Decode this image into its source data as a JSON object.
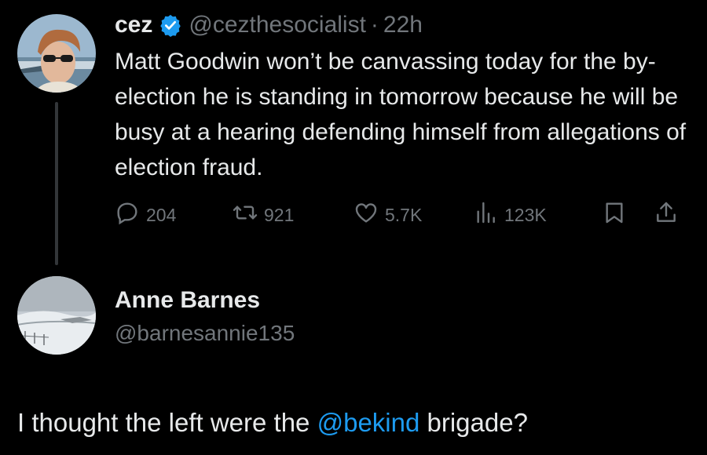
{
  "tweet": {
    "author_name": "cez",
    "handle": "@cezthesocialist",
    "separator": "·",
    "time": "22h",
    "text": "Matt Goodwin won’t be canvassing today for the by-election he is standing in tomorrow because he will be busy at a hearing defending himself from allegations of election fraud.",
    "actions": {
      "replies": "204",
      "reposts": "921",
      "likes": "5.7K",
      "views": "123K"
    }
  },
  "reply": {
    "author_name": "Anne Barnes",
    "handle": "@barnesannie135",
    "text_before": "I thought the left were the ",
    "mention": "@bekind",
    "text_after": " brigade?"
  },
  "colors": {
    "background": "#000000",
    "text": "#e7e9ea",
    "secondary": "#71767b",
    "accent": "#1d9bf0",
    "thread_line": "#333639"
  }
}
